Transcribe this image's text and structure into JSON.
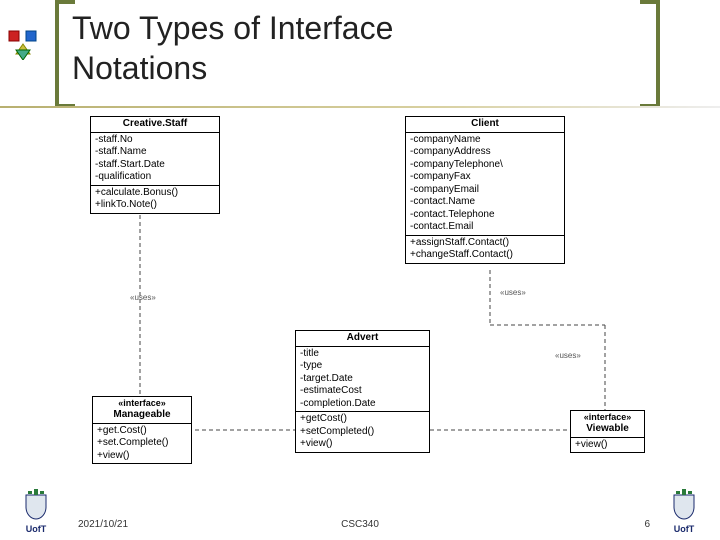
{
  "slide": {
    "title": "Two Types of Interface\nNotations"
  },
  "boxes": {
    "creativeStaff": {
      "name": "Creative.Staff",
      "attrs": [
        "-staff.No",
        "-staff.Name",
        "-staff.Start.Date",
        "-qualification"
      ],
      "ops": [
        "+calculate.Bonus()",
        "+linkTo.Note()"
      ]
    },
    "client": {
      "name": "Client",
      "attrs": [
        "-companyName",
        "-companyAddress",
        "-companyTelephone\\",
        "-companyFax",
        "-companyEmail",
        "-contact.Name",
        "-contact.Telephone",
        "-contact.Email"
      ],
      "ops": [
        "+assignStaff.Contact()",
        "+changeStaff.Contact()"
      ]
    },
    "advert": {
      "name": "Advert",
      "attrs": [
        "-title",
        "-type",
        "-target.Date",
        "-estimateCost",
        "-completion.Date"
      ],
      "ops": [
        "+getCost()",
        "+setCompleted()",
        "+view()"
      ]
    },
    "manageable": {
      "stereo": "«interface»",
      "name": "Manageable",
      "ops": [
        "+get.Cost()",
        "+set.Complete()",
        "+view()"
      ]
    },
    "viewable": {
      "stereo": "«interface»",
      "name": "Viewable",
      "ops": [
        "+view()"
      ]
    }
  },
  "labels": {
    "uses1": "«uses»",
    "uses2": "«uses»",
    "uses3": "«uses»"
  },
  "footer": {
    "date": "2021/10/21",
    "course": "CSC340",
    "page": "6",
    "brand": "UofT"
  }
}
